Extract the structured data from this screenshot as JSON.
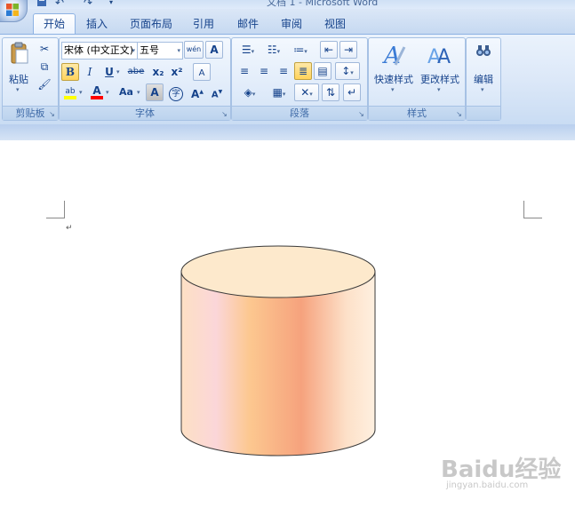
{
  "window": {
    "title": "文档 1 - Microsoft Word"
  },
  "quick_access": {
    "items": [
      "save-icon",
      "undo-icon",
      "redo-icon",
      "customize-icon"
    ]
  },
  "tabs": [
    {
      "label": "开始",
      "selected": true
    },
    {
      "label": "插入"
    },
    {
      "label": "页面布局"
    },
    {
      "label": "引用"
    },
    {
      "label": "邮件"
    },
    {
      "label": "审阅"
    },
    {
      "label": "视图"
    }
  ],
  "ribbon": {
    "clipboard": {
      "label": "剪贴板",
      "paste_label": "粘贴"
    },
    "font": {
      "label": "字体",
      "font_name": "宋体 (中文正文)",
      "font_size": "五号",
      "bold": "B",
      "italic": "I",
      "underline": "U",
      "strike": "abe",
      "subscript": "x₂",
      "superscript": "x²",
      "change_case": "Aa",
      "grow": "A",
      "shrink": "A",
      "phonetic": "wén",
      "char_border": "A",
      "char_shading": "A",
      "enclose": "字",
      "clear_format": "A",
      "colors": {
        "highlight": "#ffff00",
        "font_color": "#ff0000"
      }
    },
    "paragraph": {
      "label": "段落"
    },
    "styles": {
      "label": "样式",
      "quick_styles": "快速样式",
      "change_styles": "更改样式"
    },
    "editing": {
      "label": "",
      "edit": "编辑"
    }
  },
  "document": {
    "paragraph_mark": "↵"
  },
  "cylinder": {
    "top_color": "#fde9cc",
    "gradient_colors": [
      "#fde0c4",
      "#fbd6d9",
      "#fcc890",
      "#f6a27d",
      "#fde0c8",
      "#fef0e0"
    ]
  },
  "watermark": {
    "brand": "Baidu经验",
    "url": "jingyan.baidu.com"
  }
}
